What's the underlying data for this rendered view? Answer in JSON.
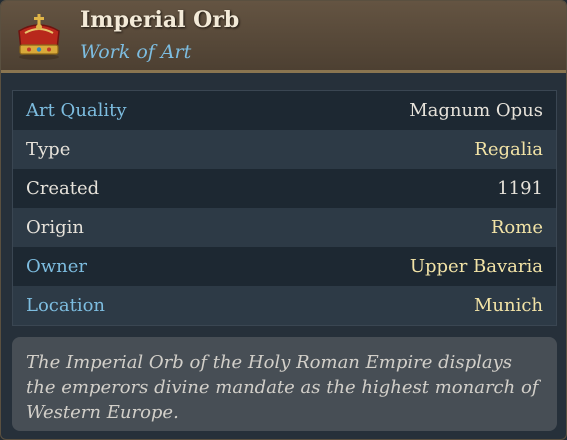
{
  "header": {
    "title": "Imperial Orb",
    "subtitle": "Work of Art",
    "icon": "crown-icon"
  },
  "rows": [
    {
      "label": "Art Quality",
      "value": "Magnum Opus"
    },
    {
      "label": "Type",
      "value": "Regalia"
    },
    {
      "label": "Created",
      "value": "1191"
    },
    {
      "label": "Origin",
      "value": "Rome"
    },
    {
      "label": "Owner",
      "value": "Upper Bavaria"
    },
    {
      "label": "Location",
      "value": "Munich"
    }
  ],
  "description": "The Imperial Orb of the Holy Roman Empire displays the emperors divine mandate as the highest monarch of Western Europe.",
  "colors": {
    "accent_blue": "#7dbde0",
    "gold_value": "#f2e3a6",
    "header_bg": "#5a4a3a"
  }
}
